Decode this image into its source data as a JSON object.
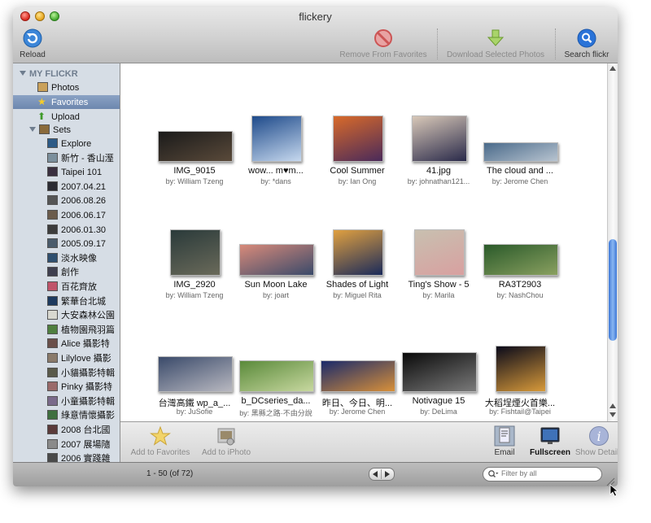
{
  "window": {
    "title": "flickery"
  },
  "toolbar": {
    "reload": "Reload",
    "remove_fav": "Remove From Favorites",
    "download": "Download Selected Photos",
    "search": "Search flickr"
  },
  "sidebar": {
    "header": "MY FLICKR",
    "photos": "Photos",
    "favorites": "Favorites",
    "upload": "Upload",
    "sets": "Sets",
    "set_items": [
      "Explore",
      "新竹 - 香山溼",
      "Taipei 101",
      "2007.04.21",
      "2006.08.26",
      "2006.06.17",
      "2006.01.30",
      "2005.09.17",
      "淡水映像",
      "創作",
      "百花齊放",
      "繁華台北城",
      "大安森林公園",
      "植物園飛羽篇",
      "Alice 攝影特",
      "Lilylove 攝影",
      "小貓攝影特輯",
      "Pinky 攝影特",
      "小童攝影特輯",
      "綠意情懷攝影",
      "2008 台北國",
      "2007 展場隨",
      "2006 實踐雜"
    ]
  },
  "grid": {
    "rows": [
      [
        {
          "title": "IMG_9015",
          "by": "by: William Tzeng"
        },
        {
          "title": "wow... m♥m...",
          "by": "by: *dans"
        },
        {
          "title": "Cool Summer",
          "by": "by: Ian Ong"
        },
        {
          "title": "41.jpg",
          "by": "by: johnathan121..."
        },
        {
          "title": "The cloud and ...",
          "by": "by: Jerome Chen"
        }
      ],
      [
        {
          "title": "IMG_2920",
          "by": "by: William Tzeng"
        },
        {
          "title": "Sun Moon Lake",
          "by": "by: joart"
        },
        {
          "title": "Shades of Light",
          "by": "by: Miguel Rita"
        },
        {
          "title": "Ting's Show - 5",
          "by": "by: Marila"
        },
        {
          "title": "RA3T2903",
          "by": "by: NashChou"
        }
      ],
      [
        {
          "title": "台灣高鐵 wp_a_...",
          "by": "by: JuSofie"
        },
        {
          "title": "b_DCseries_da...",
          "by": "by: 黑縣之路·不由分說"
        },
        {
          "title": "昨日、今日、明...",
          "by": "by: Jerome Chen"
        },
        {
          "title": "Notivague 15",
          "by": "by: DeLima"
        },
        {
          "title": "大稻埕煙火首樂...",
          "by": "by: Fishtail@Taipei"
        }
      ]
    ]
  },
  "bottom": {
    "add_fav": "Add to Favorites",
    "add_iphoto": "Add to iPhoto",
    "email": "Email",
    "fullscreen": "Fullscreen",
    "details": "Show Details"
  },
  "status": {
    "count": "1 - 50 (of 72)",
    "filter_placeholder": "Filter by all"
  }
}
